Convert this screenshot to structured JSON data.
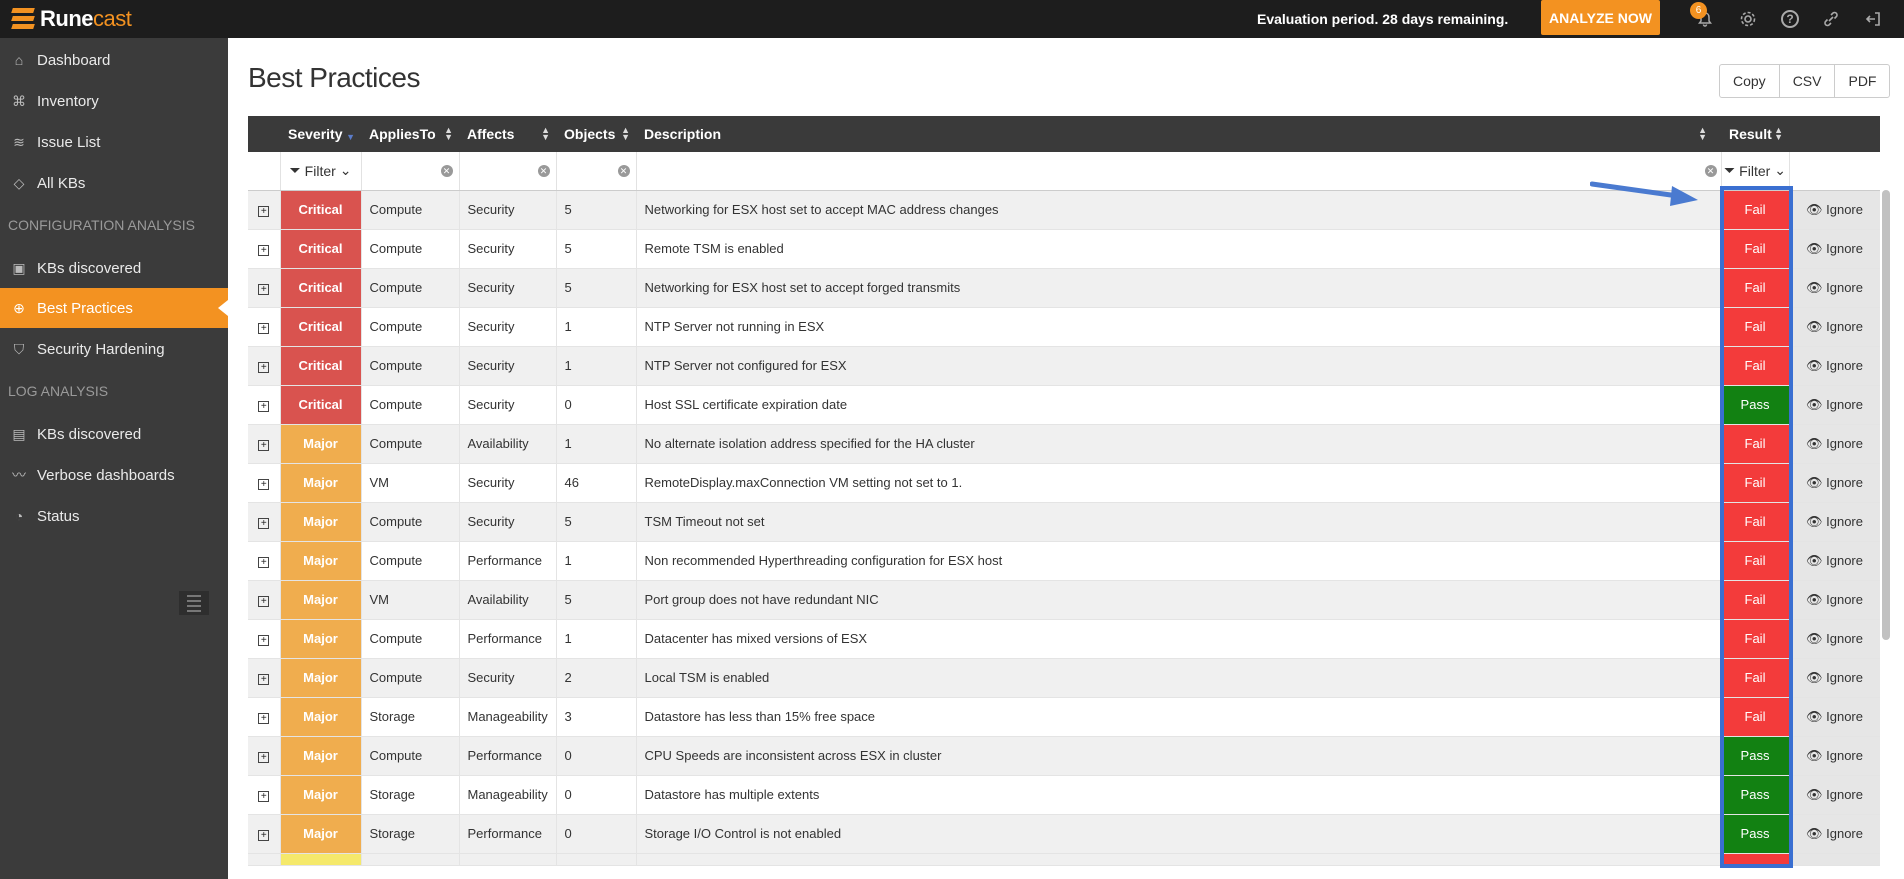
{
  "app": {
    "brand_first": "Rune",
    "brand_second": "cast",
    "evaluation_notice": "Evaluation period. 28 days remaining.",
    "analyze_label": "ANALYZE NOW",
    "notification_count": "6"
  },
  "sidebar": {
    "items_top": [
      {
        "label": "Dashboard",
        "icon": "home-icon"
      },
      {
        "label": "Inventory",
        "icon": "inventory-icon"
      },
      {
        "label": "Issue List",
        "icon": "layers-icon"
      },
      {
        "label": "All KBs",
        "icon": "diamond-icon"
      }
    ],
    "section_config": "CONFIGURATION ANALYSIS",
    "items_config": [
      {
        "label": "KBs discovered",
        "icon": "box-icon"
      },
      {
        "label": "Best Practices",
        "icon": "globe-icon",
        "active": true
      },
      {
        "label": "Security Hardening",
        "icon": "shield-icon"
      }
    ],
    "section_log": "LOG ANALYSIS",
    "items_log": [
      {
        "label": "KBs discovered",
        "icon": "book-icon"
      },
      {
        "label": "Verbose dashboards",
        "icon": "chart-line-icon"
      },
      {
        "label": "Status",
        "icon": "gauge-icon"
      }
    ]
  },
  "page": {
    "title": "Best Practices",
    "export": {
      "copy": "Copy",
      "csv": "CSV",
      "pdf": "PDF"
    }
  },
  "table": {
    "headers": {
      "severity": "Severity",
      "applies_to": "AppliesTo",
      "affects": "Affects",
      "objects": "Objects",
      "description": "Description",
      "result": "Result"
    },
    "filter_label": "Filter",
    "ignore_label": "Ignore",
    "rows": [
      {
        "severity": "Critical",
        "applies_to": "Compute",
        "affects": "Security",
        "objects": "5",
        "description": "Networking for ESX host set to accept MAC address changes",
        "result": "Fail"
      },
      {
        "severity": "Critical",
        "applies_to": "Compute",
        "affects": "Security",
        "objects": "5",
        "description": "Remote TSM is enabled",
        "result": "Fail"
      },
      {
        "severity": "Critical",
        "applies_to": "Compute",
        "affects": "Security",
        "objects": "5",
        "description": "Networking for ESX host set to accept forged transmits",
        "result": "Fail"
      },
      {
        "severity": "Critical",
        "applies_to": "Compute",
        "affects": "Security",
        "objects": "1",
        "description": "NTP Server not running in ESX",
        "result": "Fail"
      },
      {
        "severity": "Critical",
        "applies_to": "Compute",
        "affects": "Security",
        "objects": "1",
        "description": "NTP Server not configured for ESX",
        "result": "Fail"
      },
      {
        "severity": "Critical",
        "applies_to": "Compute",
        "affects": "Security",
        "objects": "0",
        "description": "Host SSL certificate expiration date",
        "result": "Pass"
      },
      {
        "severity": "Major",
        "applies_to": "Compute",
        "affects": "Availability",
        "objects": "1",
        "description": "No alternate isolation address specified for the HA cluster",
        "result": "Fail"
      },
      {
        "severity": "Major",
        "applies_to": "VM",
        "affects": "Security",
        "objects": "46",
        "description": "RemoteDisplay.maxConnection VM setting not set to 1.",
        "result": "Fail"
      },
      {
        "severity": "Major",
        "applies_to": "Compute",
        "affects": "Security",
        "objects": "5",
        "description": "TSM Timeout not set",
        "result": "Fail"
      },
      {
        "severity": "Major",
        "applies_to": "Compute",
        "affects": "Performance",
        "objects": "1",
        "description": "Non recommended Hyperthreading configuration for ESX host",
        "result": "Fail"
      },
      {
        "severity": "Major",
        "applies_to": "VM",
        "affects": "Availability",
        "objects": "5",
        "description": "Port group does not have redundant NIC",
        "result": "Fail"
      },
      {
        "severity": "Major",
        "applies_to": "Compute",
        "affects": "Performance",
        "objects": "1",
        "description": "Datacenter has mixed versions of ESX",
        "result": "Fail"
      },
      {
        "severity": "Major",
        "applies_to": "Compute",
        "affects": "Security",
        "objects": "2",
        "description": "Local TSM is enabled",
        "result": "Fail"
      },
      {
        "severity": "Major",
        "applies_to": "Storage",
        "affects": "Manageability",
        "objects": "3",
        "description": "Datastore has less than 15% free space",
        "result": "Fail"
      },
      {
        "severity": "Major",
        "applies_to": "Compute",
        "affects": "Performance",
        "objects": "0",
        "description": "CPU Speeds are inconsistent across ESX in cluster",
        "result": "Pass"
      },
      {
        "severity": "Major",
        "applies_to": "Storage",
        "affects": "Manageability",
        "objects": "0",
        "description": "Datastore has multiple extents",
        "result": "Pass"
      },
      {
        "severity": "Major",
        "applies_to": "Storage",
        "affects": "Performance",
        "objects": "0",
        "description": "Storage I/O Control is not enabled",
        "result": "Pass"
      }
    ]
  },
  "colors": {
    "brand_orange": "#f39221",
    "critical": "#d9534f",
    "major": "#f0ad4e",
    "fail": "#f33b3b",
    "pass": "#128112",
    "highlight": "#3a6fd1"
  }
}
